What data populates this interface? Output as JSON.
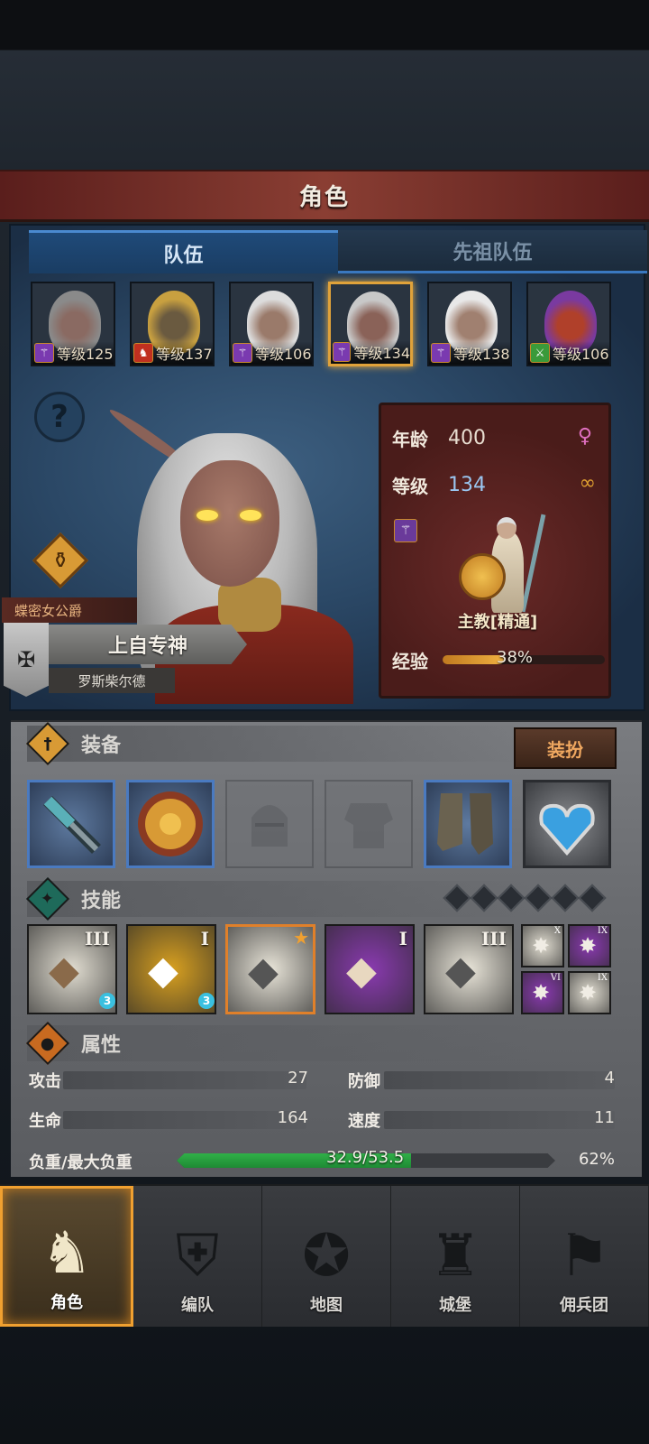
{
  "header": {
    "title": "角色"
  },
  "tabs": [
    {
      "label": "队伍",
      "active": true
    },
    {
      "label": "先祖队伍",
      "active": false
    }
  ],
  "roster": [
    {
      "level": "等级125",
      "class_icon": "staff-icon",
      "badge_color": "#7a3ab0",
      "hair": "#8a8a8a",
      "skin": "#8a6a62",
      "selected": false
    },
    {
      "level": "等级137",
      "class_icon": "horse-icon",
      "badge_color": "#c03020",
      "hair": "#c8a040",
      "skin": "#6a5a40",
      "selected": false
    },
    {
      "level": "等级106",
      "class_icon": "staff-icon",
      "badge_color": "#7a3ab0",
      "hair": "#dcdcdc",
      "skin": "#9a7a6a",
      "selected": false
    },
    {
      "level": "等级134",
      "class_icon": "staff-icon",
      "badge_color": "#7a3ab0",
      "hair": "#c8c8c8",
      "skin": "#8a6258",
      "selected": true
    },
    {
      "level": "等级138",
      "class_icon": "staff-icon",
      "badge_color": "#7a3ab0",
      "hair": "#e8e8e8",
      "skin": "#a08070",
      "selected": false
    },
    {
      "level": "等级106",
      "class_icon": "sword-icon",
      "badge_color": "#3a9a3a",
      "hair": "#7a3aa0",
      "skin": "#b0402a",
      "selected": false
    }
  ],
  "hero": {
    "title": "蝶密女公爵",
    "faith": "上自专神",
    "realm": "罗斯柴尔德",
    "age_label": "年龄",
    "age": "400",
    "level_label": "等级",
    "level": "134",
    "class_name": "主教[精通]",
    "exp_label": "经验",
    "exp_text": "38%",
    "exp_fraction": 0.38,
    "gender_symbol": "♀",
    "ring_symbol": "∞"
  },
  "equipment": {
    "title": "装备",
    "dress_button": "装扮",
    "slots": [
      {
        "name": "weapon-mace",
        "state": "filled",
        "icon": "mace-icon"
      },
      {
        "name": "shield",
        "state": "filled",
        "icon": "sun-shield-icon"
      },
      {
        "name": "helmet",
        "state": "empty",
        "icon": "helmet-icon"
      },
      {
        "name": "armor",
        "state": "empty",
        "icon": "armor-icon"
      },
      {
        "name": "boots",
        "state": "filled",
        "icon": "boots-icon"
      },
      {
        "name": "necklace",
        "state": "neck",
        "icon": "heart-amulet-icon"
      }
    ]
  },
  "skills": {
    "title": "技能",
    "main": [
      {
        "rank": "III",
        "bg": "#e0dcd0",
        "fg": "#8a6a4a",
        "badge": "3",
        "icon": "drain-crystal-icon"
      },
      {
        "rank": "I",
        "bg": "#d8a020",
        "fg": "#fff",
        "badge": "3",
        "icon": "holy-shield-icon"
      },
      {
        "rank": "",
        "bg": "#e8e4d8",
        "fg": "#555",
        "badge": "",
        "icon": "sanctuary-icon",
        "star": true
      },
      {
        "rank": "I",
        "bg": "#8a3ab0",
        "fg": "#e8d8c0",
        "badge": "",
        "icon": "crystal-hand-icon"
      },
      {
        "rank": "III",
        "bg": "#e8e4d8",
        "fg": "#555",
        "badge": "",
        "icon": "crystal-hand-icon"
      }
    ],
    "small": [
      {
        "rank": "X",
        "bg": "#e0dcd0",
        "icon": "burst-icon"
      },
      {
        "rank": "IX",
        "bg": "#8a3ab0",
        "icon": "burst-icon"
      },
      {
        "rank": "VI",
        "bg": "#8a3ab0",
        "icon": "staff-strike-icon"
      },
      {
        "rank": "IX",
        "bg": "#e0dcd0",
        "icon": "shatter-icon"
      }
    ]
  },
  "attributes": {
    "title": "属性",
    "attack_label": "攻击",
    "attack": "27",
    "defense_label": "防御",
    "defense": "4",
    "hp_label": "生命",
    "hp": "164",
    "speed_label": "速度",
    "speed": "11",
    "load_label": "负重/最大负重",
    "load_text": "32.9/53.5",
    "load_pct": "62%",
    "load_fraction": 0.62
  },
  "nav": [
    {
      "label": "角色",
      "icon": "knight-icon",
      "glyph": "♞",
      "active": true
    },
    {
      "label": "编队",
      "icon": "helmet-icon",
      "glyph": "⛨",
      "active": false
    },
    {
      "label": "地图",
      "icon": "compass-map-icon",
      "glyph": "✪",
      "active": false
    },
    {
      "label": "城堡",
      "icon": "castle-icon",
      "glyph": "♜",
      "active": false
    },
    {
      "label": "佣兵团",
      "icon": "banner-icon",
      "glyph": "⚑",
      "active": false
    }
  ]
}
